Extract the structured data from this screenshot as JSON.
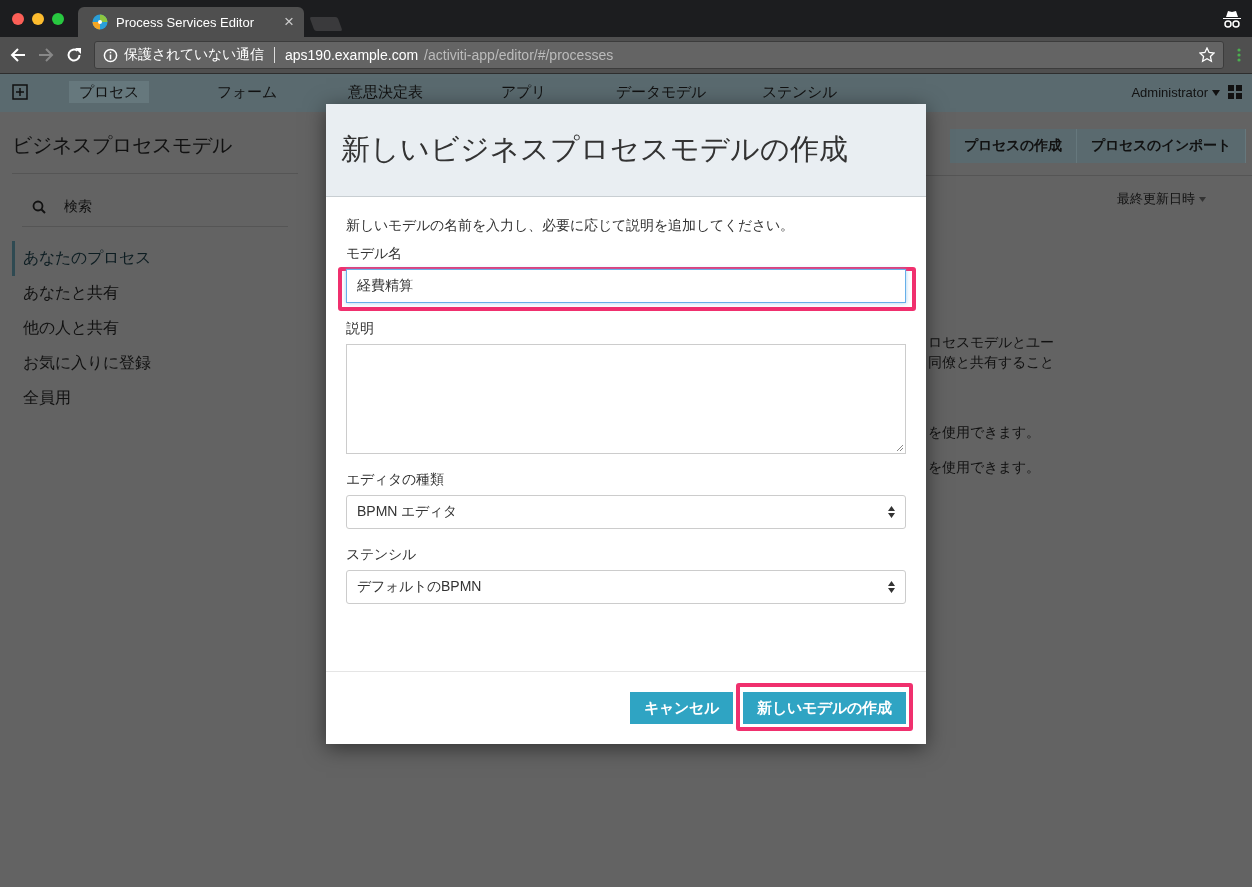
{
  "browser": {
    "tab": {
      "title": "Process Services Editor",
      "close": "×"
    },
    "address": {
      "security": "保護されていない通信",
      "host": "aps190.example.com",
      "path": "/activiti-app/editor/#/processes"
    }
  },
  "app": {
    "nav": [
      {
        "label": "プロセス",
        "selected": true
      },
      {
        "label": "フォーム",
        "selected": false
      },
      {
        "label": "意思決定表",
        "selected": false
      },
      {
        "label": "アプリ",
        "selected": false
      },
      {
        "label": "データモデル",
        "selected": false
      },
      {
        "label": "ステンシル",
        "selected": false
      }
    ],
    "user": "Administrator",
    "page_title": "ビジネスプロセスモデル",
    "search": {
      "placeholder": "検索"
    },
    "filters": [
      {
        "label": "あなたのプロセス",
        "selected": true
      },
      {
        "label": "あなたと共有",
        "selected": false
      },
      {
        "label": "他の人と共有",
        "selected": false
      },
      {
        "label": "お気に入りに登録",
        "selected": false
      },
      {
        "label": "全員用",
        "selected": false
      }
    ],
    "actions": [
      "プロセスの作成",
      "プロセスのインポート"
    ],
    "sort": "最終更新日時",
    "body_lines": [
      "ロセスモデルとユー",
      "同僚と共有すること",
      "を使用できます。",
      "を使用できます。"
    ]
  },
  "dialog": {
    "title": "新しいビジネスプロセスモデルの作成",
    "intro": "新しいモデルの名前を入力し、必要に応じて説明を追加してください。",
    "fields": [
      {
        "kind": "text",
        "label": "モデル名",
        "value": "経費精算",
        "highlighted": true
      },
      {
        "kind": "textarea",
        "label": "説明",
        "highlighted": false
      },
      {
        "kind": "select",
        "label": "エディタの種類",
        "value": "BPMN エディタ",
        "highlighted": false
      },
      {
        "kind": "select",
        "label": "ステンシル",
        "value": "デフォルトのBPMN",
        "highlighted": false
      }
    ],
    "buttons": [
      {
        "label": "キャンセル",
        "highlighted": false
      },
      {
        "label": "新しいモデルの作成",
        "highlighted": true
      }
    ]
  }
}
